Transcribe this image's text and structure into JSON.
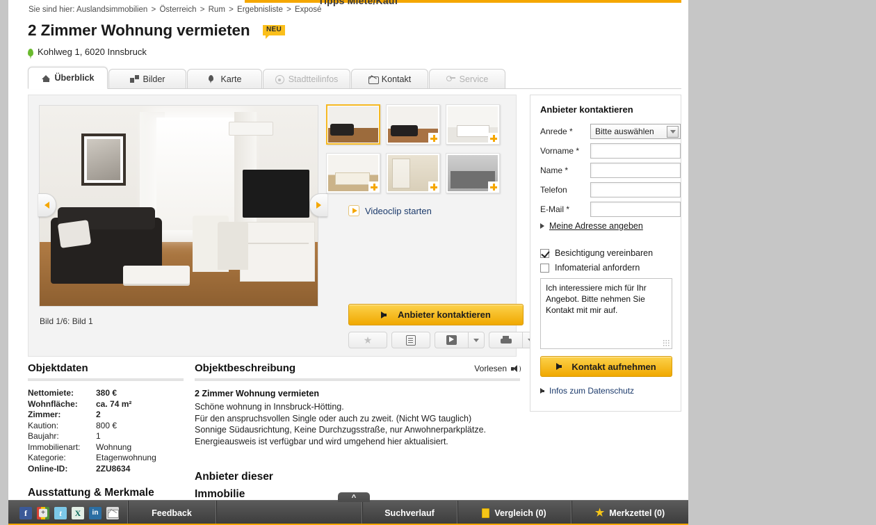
{
  "meta": {
    "accent_orange": "#f5a700",
    "accent_yellow": "#fbbf1b",
    "page_bg": "#ffffff",
    "desktop_bg": "#c6c6c6"
  },
  "topbar": {
    "tipps_label": "Tipps Miete/Kauf"
  },
  "breadcrumb": {
    "prefix": "Sie sind hier:",
    "items": [
      "Auslandsimmobilien",
      "Österreich",
      "Rum",
      "Ergebnisliste",
      "Exposé"
    ],
    "separator": ">"
  },
  "header": {
    "title": "2 Zimmer Wohnung vermieten",
    "badge": "NEU",
    "address": "Kohlweg 1, 6020 Innsbruck",
    "pin_icon": "map-pin-icon"
  },
  "tabs": [
    {
      "label": "Überblick",
      "icon": "home-icon",
      "state": "active"
    },
    {
      "label": "Bilder",
      "icon": "images-icon",
      "state": "normal"
    },
    {
      "label": "Karte",
      "icon": "map-pin-icon",
      "state": "normal"
    },
    {
      "label": "Stadtteilinfos",
      "icon": "circle-dot-icon",
      "state": "disabled"
    },
    {
      "label": "Kontakt",
      "icon": "envelope-icon",
      "state": "normal"
    },
    {
      "label": "Service",
      "icon": "service-icon",
      "state": "disabled"
    }
  ],
  "gallery": {
    "caption": "Bild 1/6: Bild 1",
    "prev_icon": "arrow-left-icon",
    "next_icon": "arrow-right-icon",
    "videoclip_label": "Videoclip starten",
    "play_icon": "play-icon",
    "thumbnails": [
      {
        "alt": "Bild 1",
        "selected": true,
        "scene": "livingA"
      },
      {
        "alt": "Bild 2",
        "selected": false,
        "scene": "livingB"
      },
      {
        "alt": "Bild 3",
        "selected": false,
        "scene": "bedA"
      },
      {
        "alt": "Bild 4",
        "selected": false,
        "scene": "bedB"
      },
      {
        "alt": "Bild 5",
        "selected": false,
        "scene": "bath"
      },
      {
        "alt": "Bild 6",
        "selected": false,
        "scene": "kitchen"
      }
    ],
    "contact_button": "Anbieter kontaktieren",
    "tools": [
      {
        "name": "merkzettel-button",
        "icon": "star-icon"
      },
      {
        "name": "notes-button",
        "icon": "note-icon"
      },
      {
        "name": "share-button",
        "icon": "share-icon"
      },
      {
        "name": "share-dropdown",
        "icon": "chevron-down-icon"
      },
      {
        "name": "print-button",
        "icon": "printer-icon"
      },
      {
        "name": "print-dropdown",
        "icon": "chevron-down-icon"
      }
    ]
  },
  "contact_form": {
    "title": "Anbieter kontaktieren",
    "fields": [
      {
        "label": "Anrede *",
        "type": "select",
        "value": "Bitte auswählen",
        "placeholder": ""
      },
      {
        "label": "Vorname *",
        "type": "text",
        "value": "",
        "placeholder": ""
      },
      {
        "label": "Name *",
        "type": "text",
        "value": "",
        "placeholder": ""
      },
      {
        "label": "Telefon",
        "type": "text",
        "value": "",
        "placeholder": ""
      },
      {
        "label": "E-Mail *",
        "type": "text",
        "value": "",
        "placeholder": ""
      }
    ],
    "address_toggle": "Meine Adresse angeben",
    "checkboxes": [
      {
        "label": "Besichtigung vereinbaren",
        "checked": true
      },
      {
        "label": "Infomaterial anfordern",
        "checked": false
      }
    ],
    "message": "Ich interessiere mich für Ihr Angebot. Bitte nehmen Sie Kontakt mit mir auf.",
    "submit_label": "Kontakt aufnehmen",
    "privacy_link": "Infos zum Datenschutz"
  },
  "objektdaten": {
    "heading": "Objektdaten",
    "rows": [
      {
        "key": "Nettomiete:",
        "value": "380 €",
        "bold": true
      },
      {
        "key": "Wohnfläche:",
        "value": "ca. 74 m²",
        "bold": true
      },
      {
        "key": "Zimmer:",
        "value": "2",
        "bold": true
      },
      {
        "key": "Kaution:",
        "value": "800 €",
        "bold": false
      },
      {
        "key": "Baujahr:",
        "value": "1",
        "bold": false
      },
      {
        "key": "Immobilienart:",
        "value": "Wohnung",
        "bold": false
      },
      {
        "key": "Kategorie:",
        "value": "Etagenwohnung",
        "bold": false
      },
      {
        "key": "Online-ID:",
        "value": "2ZU8634",
        "bold": true
      }
    ]
  },
  "objektbeschreibung": {
    "heading": "Objektbeschreibung",
    "vorlesen_label": "Vorlesen",
    "speaker_icon": "speaker-icon",
    "subtitle": "2 Zimmer Wohnung vermieten",
    "lines": [
      "Schöne wohnung in Innsbruck-Hötting.",
      "Für den anspruchsvollen Single oder auch zu zweit. (Nicht WG tauglich)",
      "Sonnige Südausrichtung, Keine Durchzugsstraße, nur Anwohnerparkplätze.",
      "Energieausweis ist verfügbar und wird umgehend hier aktualisiert."
    ]
  },
  "anbieter_heading_line1": "Anbieter dieser",
  "anbieter_heading_line2": "Immobilie",
  "ausstattung_heading": "Ausstattung & Merkmale",
  "bottombar": {
    "social": [
      {
        "name": "facebook-icon",
        "glyph": "f"
      },
      {
        "name": "google-plus-icon",
        "glyph": ""
      },
      {
        "name": "twitter-icon",
        "glyph": "t"
      },
      {
        "name": "xing-icon",
        "glyph": "X"
      },
      {
        "name": "linkedin-icon",
        "glyph": "in"
      },
      {
        "name": "email-icon",
        "glyph": ""
      }
    ],
    "feedback_label": "Feedback",
    "collapse_glyph": "^",
    "items": [
      {
        "label": "Suchverlauf",
        "icon": ""
      },
      {
        "label": "Vergleich (0)",
        "icon": "document-icon"
      },
      {
        "label": "Merkzettel (0)",
        "icon": "star-icon"
      }
    ]
  }
}
